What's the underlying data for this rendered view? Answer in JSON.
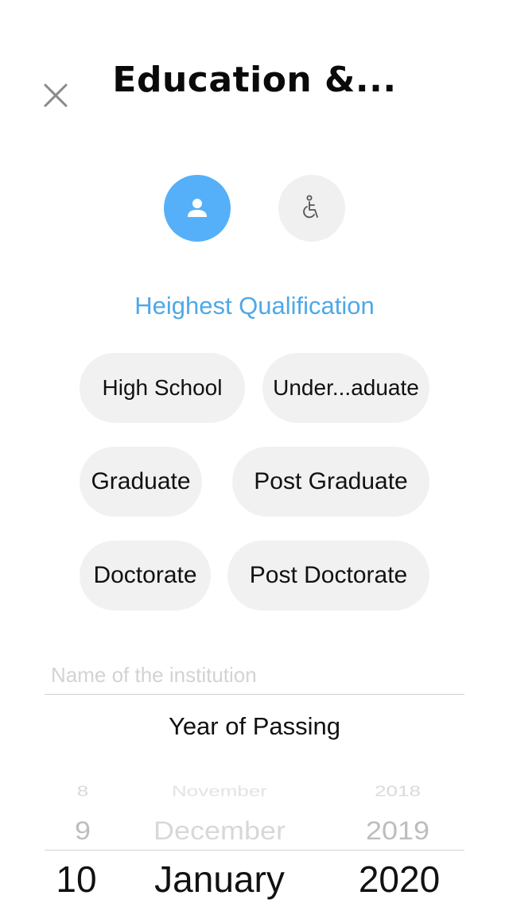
{
  "header": {
    "title": "Education &..."
  },
  "steps": [
    {
      "icon": "person-icon",
      "active": true,
      "color": "#55b0f9"
    },
    {
      "icon": "wheelchair-icon",
      "active": false,
      "color": "#f0f0f0"
    }
  ],
  "qualification": {
    "heading": "Heighest Qualification",
    "options": [
      "High School",
      "Under...aduate",
      "Graduate",
      "Post Graduate",
      "Doctorate",
      "Post Doctorate"
    ]
  },
  "institution": {
    "value": "",
    "placeholder": "Name of the institution"
  },
  "year_of_passing": {
    "label": "Year of Passing",
    "picker": {
      "day": [
        "8",
        "9",
        "10"
      ],
      "month": [
        "November",
        "December",
        "January"
      ],
      "year": [
        "2018",
        "2019",
        "2020"
      ],
      "selected": {
        "day": "10",
        "month": "January",
        "year": "2020"
      }
    }
  },
  "colors": {
    "accent": "#55b0f9",
    "heading": "#4fa8e6",
    "chip_bg": "#f1f1f1"
  }
}
